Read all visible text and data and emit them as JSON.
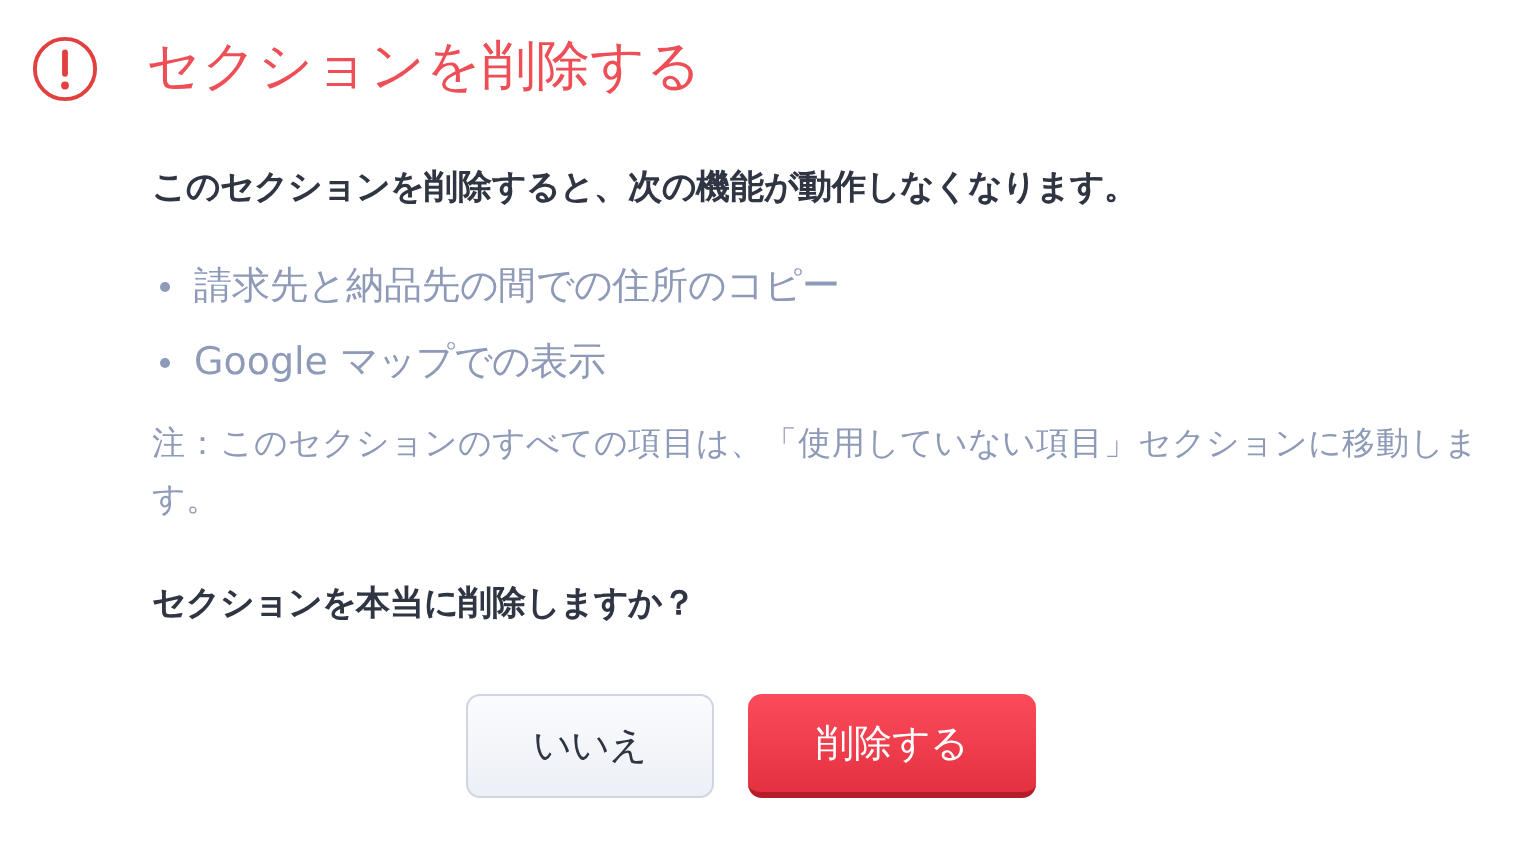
{
  "dialog": {
    "title": "セクションを削除する",
    "intro": "このセクションを削除すると、次の機能が動作しなくなります。",
    "features": [
      "請求先と納品先の間での住所のコピー",
      "Google マップでの表示"
    ],
    "note": "注：このセクションのすべての項目は、「使用していない項目」セクションに移動します。",
    "question": "セクションを本当に削除しますか？",
    "buttons": [
      {
        "label": "いいえ",
        "kind": "secondary"
      },
      {
        "label": "削除する",
        "kind": "danger"
      }
    ]
  }
}
